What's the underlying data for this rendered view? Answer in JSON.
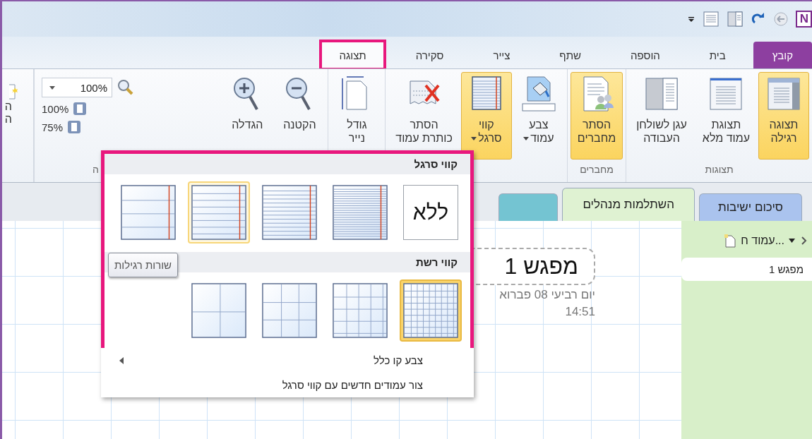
{
  "app_logo": "N",
  "ribbon_tabs": [
    {
      "label": "קובץ",
      "kind": "file",
      "selected": false,
      "highlighted": false
    },
    {
      "label": "בית",
      "kind": "tab",
      "selected": false,
      "highlighted": false
    },
    {
      "label": "הוספה",
      "kind": "tab",
      "selected": false,
      "highlighted": false
    },
    {
      "label": "שתף",
      "kind": "tab",
      "selected": false,
      "highlighted": false
    },
    {
      "label": "צייר",
      "kind": "tab",
      "selected": false,
      "highlighted": false
    },
    {
      "label": "סקירה",
      "kind": "tab",
      "selected": false,
      "highlighted": false
    },
    {
      "label": "תצוגה",
      "kind": "tab",
      "selected": true,
      "highlighted": true
    }
  ],
  "ribbon_groups": [
    {
      "label": "תצוגות",
      "kind": "buttons",
      "buttons": [
        {
          "lines": [
            "תצוגה",
            "רגילה"
          ],
          "kind": "normal",
          "selected": true,
          "dropdown": false
        },
        {
          "lines": [
            "תצוגת",
            "עמוד מלא"
          ],
          "kind": "full",
          "selected": false,
          "dropdown": false
        },
        {
          "lines": [
            "עגן לשולחן",
            "העבודה"
          ],
          "kind": "dock",
          "selected": false,
          "dropdown": false
        }
      ]
    },
    {
      "label": "מחברים",
      "kind": "buttons",
      "buttons": [
        {
          "lines": [
            "הסתר",
            "מחברים"
          ],
          "kind": "notebooks",
          "selected": true,
          "dropdown": false
        }
      ]
    },
    {
      "kind": "buttons",
      "buttons": [
        {
          "lines": [
            "צבע",
            "עמוד"
          ],
          "kind": "paint",
          "selected": false,
          "dropdown": true
        },
        {
          "lines": [
            "קווי",
            "סרגל"
          ],
          "kind": "rules",
          "selected": true,
          "dropdown": true
        },
        {
          "lines": [
            "הסתר",
            "כותרת עמוד"
          ],
          "kind": "hide-title",
          "selected": false,
          "dropdown": false
        }
      ]
    },
    {
      "kind": "buttons",
      "buttons": [
        {
          "lines": [
            "גודל",
            "נייר"
          ],
          "kind": "paper",
          "selected": false,
          "dropdown": false
        }
      ]
    },
    {
      "label": "ה",
      "kind": "zoom",
      "buttons": [
        {
          "lines": [
            "הקטנה"
          ],
          "kind": "zoom-out",
          "selected": false,
          "dropdown": false
        },
        {
          "lines": [
            "הגדלה"
          ],
          "kind": "zoom-in",
          "selected": false,
          "dropdown": false
        }
      ],
      "zoom_field": "100%",
      "zoom_presets": [
        "100%",
        "75%"
      ]
    },
    {
      "kind": "cut",
      "lines": [
        "ה",
        "ה"
      ]
    }
  ],
  "notebook_tabs": [
    {
      "label": "סיכום ישיבות",
      "color": "#aac3ee",
      "selected": false
    },
    {
      "label": "השתלמות מנהלים",
      "color": "#dff2d2",
      "selected": true
    },
    {
      "color": "#74c4d2",
      "selected": false
    }
  ],
  "page": {
    "title": "מפגש 1",
    "date": "יום רביעי 08 פברוא",
    "time": "14:51"
  },
  "page_panel": {
    "new_page": "עמוד ח...",
    "pages": [
      {
        "title": "מפגש 1",
        "selected": true
      }
    ]
  },
  "rule_lines_menu": {
    "sections": [
      {
        "title": "קווי סרגל",
        "kind": "rules",
        "options": [
          {
            "kind": "none",
            "label": "ללא",
            "selected": false,
            "hovered": false
          },
          {
            "kind": "narrow",
            "selected": false,
            "hovered": false
          },
          {
            "kind": "college",
            "selected": false,
            "hovered": false
          },
          {
            "kind": "standard",
            "selected": false,
            "hovered": true
          },
          {
            "kind": "wide",
            "selected": false,
            "hovered": false
          }
        ]
      },
      {
        "title": "קווי רשת",
        "kind": "grid",
        "options": [
          {
            "kind": "small",
            "selected": true,
            "hovered": false
          },
          {
            "kind": "medium",
            "selected": false,
            "hovered": false
          },
          {
            "kind": "large",
            "selected": false,
            "hovered": false
          },
          {
            "kind": "very-large",
            "selected": false,
            "hovered": false
          }
        ]
      }
    ],
    "tooltip": "שורות רגילות",
    "items": [
      {
        "label": "צבע קו כלל",
        "submenu": true
      },
      {
        "label": "צור עמודים חדשים עם קווי סרגל",
        "submenu": false
      }
    ]
  }
}
